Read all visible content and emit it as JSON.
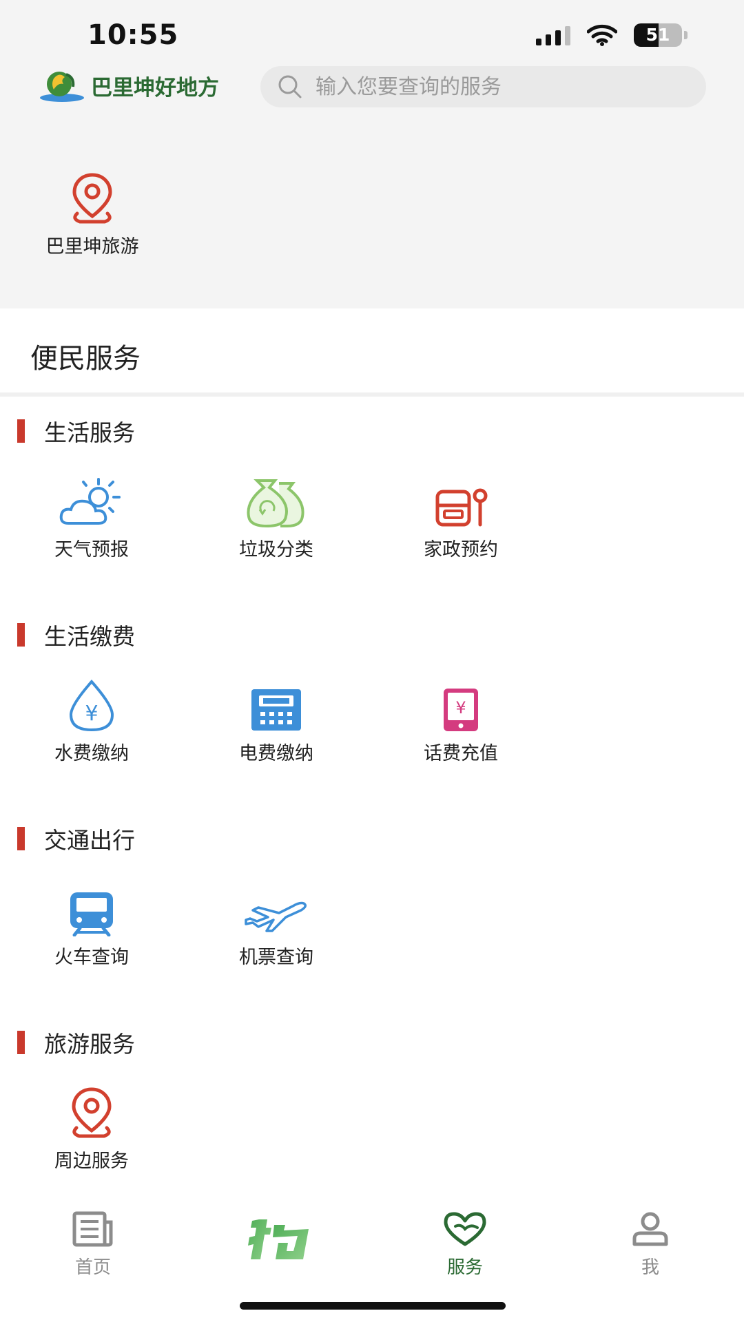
{
  "status_bar": {
    "time": "10:55",
    "battery": "51",
    "battery_level": 0.51
  },
  "header": {
    "logo_text": "巴里坤好地方",
    "search_placeholder": "输入您要查询的服务",
    "search_icon": "search-icon"
  },
  "quick_access": {
    "label": "巴里坤旅游",
    "icon": "location-pin-icon"
  },
  "section": {
    "title": "便民服务"
  },
  "categories": [
    {
      "title": "生活服务",
      "items": [
        {
          "label": "天气预报",
          "icon": "weather-icon"
        },
        {
          "label": "垃圾分类",
          "icon": "garbage-bag-icon"
        },
        {
          "label": "家政预约",
          "icon": "housekeeping-icon"
        }
      ]
    },
    {
      "title": "生活缴费",
      "items": [
        {
          "label": "水费缴纳",
          "icon": "water-drop-icon"
        },
        {
          "label": "电费缴纳",
          "icon": "electric-meter-icon"
        },
        {
          "label": "话费充值",
          "icon": "phone-recharge-icon"
        }
      ]
    },
    {
      "title": "交通出行",
      "items": [
        {
          "label": "火车查询",
          "icon": "train-icon"
        },
        {
          "label": "机票查询",
          "icon": "airplane-icon"
        }
      ]
    },
    {
      "title": "旅游服务",
      "items": [
        {
          "label": "周边服务",
          "icon": "location-pin-icon"
        }
      ]
    }
  ],
  "bottom_nav": [
    {
      "label": "首页",
      "icon": "news-icon",
      "active": false
    },
    {
      "label": "",
      "icon": "pai-logo-icon",
      "active": false
    },
    {
      "label": "服务",
      "icon": "heart-service-icon",
      "active": true
    },
    {
      "label": "我",
      "icon": "user-icon",
      "active": false
    }
  ],
  "colors": {
    "brand_green": "#2b6a33",
    "section_red": "#c9392c",
    "icon_blue": "#3d8fd8",
    "icon_green": "#8cc56a",
    "icon_pink": "#d43b7f",
    "inactive_gray": "#8c8c8c"
  }
}
